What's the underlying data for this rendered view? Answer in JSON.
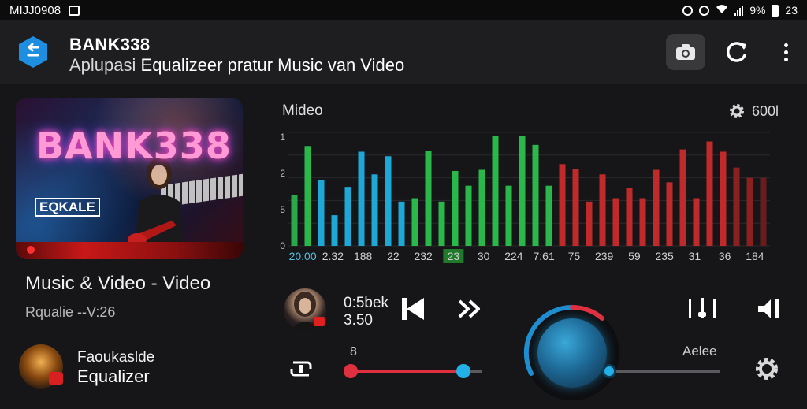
{
  "status_bar": {
    "carrier": "MIJJ0908",
    "battery": "9%",
    "time": "23"
  },
  "header": {
    "title": "BANK338",
    "subtitle_prefix": "Aplupasi",
    "subtitle_rest": "Equalizeer pratur Music van Video"
  },
  "video": {
    "thumb_title": "BANK338",
    "thumb_label": "EQKALE",
    "title": "Music & Video - Video",
    "subtitle": "Rqualie --V:26"
  },
  "playlist": {
    "name": "Faoukaslde",
    "subtitle": "Equalizer"
  },
  "equalizer": {
    "label": "Mideo",
    "settings_label": "600l"
  },
  "chart_data": {
    "type": "bar",
    "y_tick_labels": [
      "1",
      "2",
      "5",
      "0"
    ],
    "x_tick_labels": [
      "20:00",
      "2.32",
      "188",
      "22",
      "232",
      "23",
      "30",
      "224",
      "7:61",
      "75",
      "239",
      "59",
      "235",
      "31",
      "36",
      "184"
    ],
    "highlight_tick": "23",
    "bar_heights": [
      0.45,
      0.88,
      0.58,
      0.27,
      0.52,
      0.83,
      0.63,
      0.79,
      0.39,
      0.42,
      0.84,
      0.39,
      0.66,
      0.53,
      0.67,
      0.97,
      0.53,
      0.97,
      0.89,
      0.53,
      0.72,
      0.68,
      0.39,
      0.63,
      0.42,
      0.51,
      0.42,
      0.67,
      0.56,
      0.85,
      0.42,
      0.92,
      0.83,
      0.69,
      0.6,
      0.6
    ],
    "bar_colors": [
      "#2aa84a",
      "#2ab84a",
      "#1ea8d6",
      "#1ea8d6",
      "#1ea8d6",
      "#1ea8d6",
      "#1ea8d6",
      "#1ea8d6",
      "#1ea8d6",
      "#2ab84a",
      "#2ab84a",
      "#2ab84a",
      "#2ab84a",
      "#2ab84a",
      "#2ab84a",
      "#2ab84a",
      "#2ab84a",
      "#2ab84a",
      "#2ab84a",
      "#2ab84a",
      "#c02a2a",
      "#c02a2a",
      "#c02a2a",
      "#c02a2a",
      "#c02a2a",
      "#c02a2a",
      "#c02a2a",
      "#c02a2a",
      "#c02a2a",
      "#c02a2a",
      "#c02a2a",
      "#c02a2a",
      "#c02a2a",
      "#8a2020",
      "#8a2020",
      "#6a1c1c"
    ]
  },
  "player": {
    "time_primary": "0:5bek",
    "time_secondary": "3.50",
    "progress": 0.86,
    "volume_label": "Aelee",
    "volume": 0.0,
    "slider1_label": "8"
  },
  "colors": {
    "accent_blue": "#22b0e8",
    "accent_red": "#e03040",
    "brand_blue": "#1e8fe0"
  }
}
